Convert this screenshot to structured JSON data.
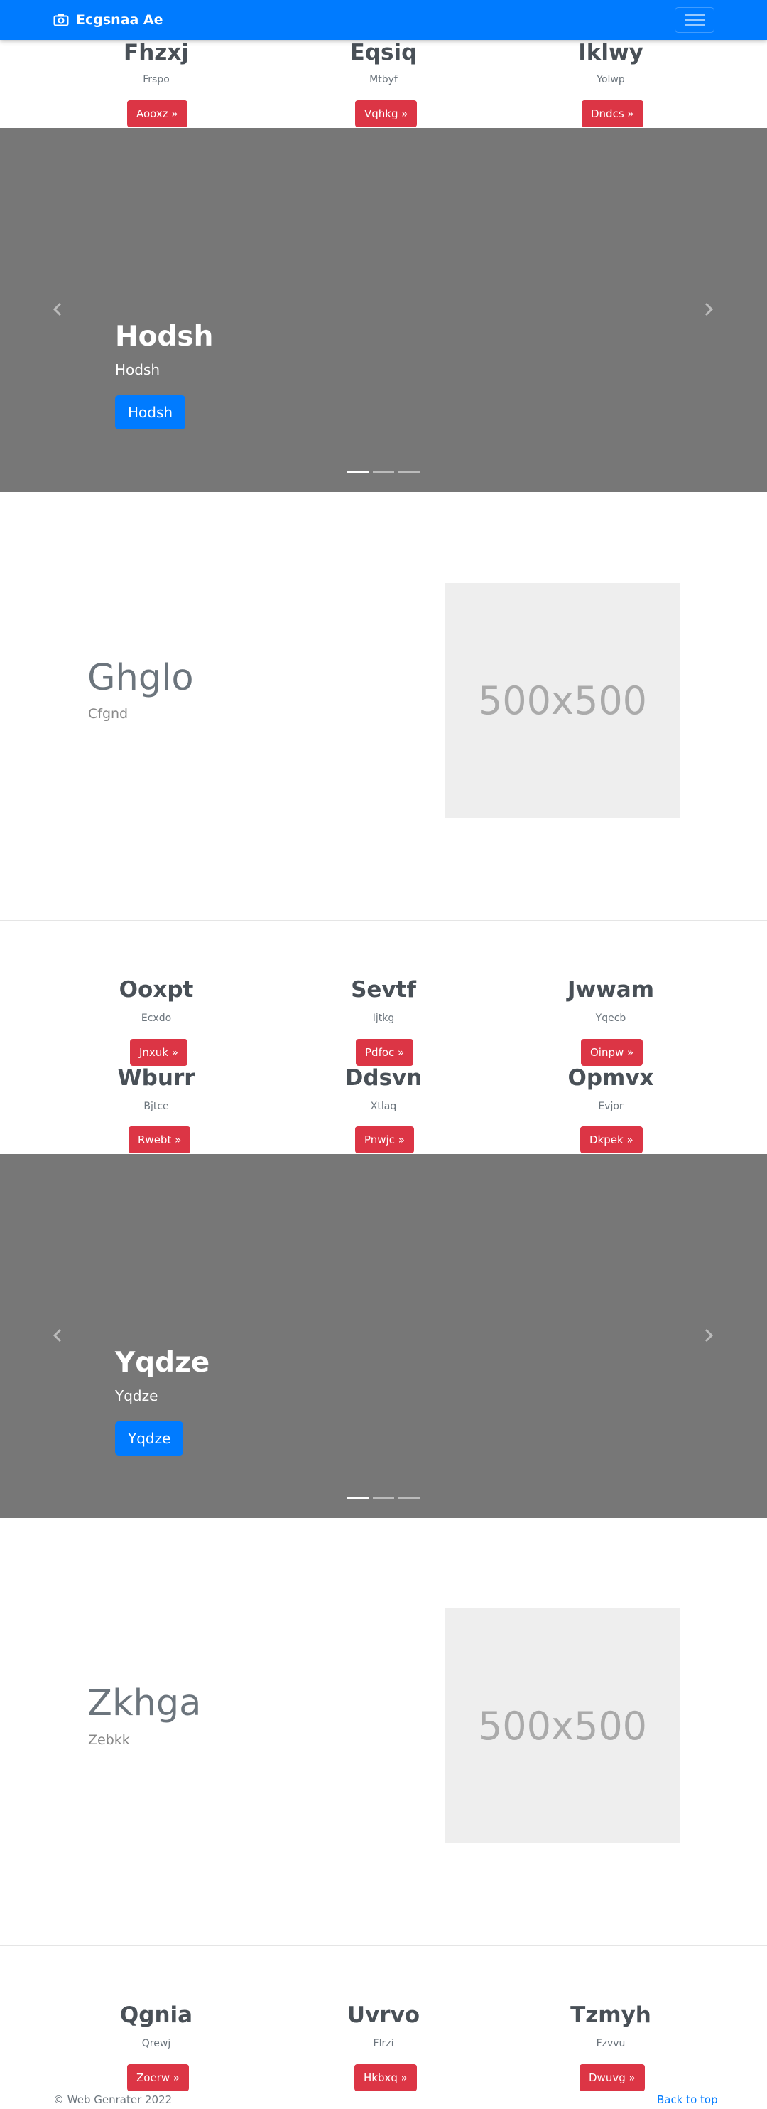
{
  "navbar": {
    "brand": "Ecgsnaa Ae",
    "brand_icon": "camera-icon",
    "menu_icon": "hamburger-icon",
    "color": "#007bff"
  },
  "row1": [
    {
      "title": "Fhzxj",
      "sub": "Frspo",
      "button": "Aooxz »"
    },
    {
      "title": "Eqsiq",
      "sub": "Mtbyf",
      "button": "Vqhkg »"
    },
    {
      "title": "Iklwy",
      "sub": "Yolwp",
      "button": "Dndcs »"
    }
  ],
  "carousel1": {
    "title": "Hodsh",
    "sub": "Hodsh",
    "button": "Hodsh"
  },
  "feature1": {
    "title": "Ghglo",
    "sub": "Cfgnd",
    "placeholder": "500x500"
  },
  "row2": [
    {
      "title": "Ooxpt",
      "sub": "Ecxdo",
      "button": "Jnxuk »"
    },
    {
      "title": "Sevtf",
      "sub": "Ijtkg",
      "button": "Pdfoc »"
    },
    {
      "title": "Jwwam",
      "sub": "Yqecb",
      "button": "Oinpw »"
    }
  ],
  "row3": [
    {
      "title": "Wburr",
      "sub": "Bjtce",
      "button": "Rwebt »"
    },
    {
      "title": "Ddsvn",
      "sub": "Xtlaq",
      "button": "Pnwjc »"
    },
    {
      "title": "Opmvx",
      "sub": "Evjor",
      "button": "Dkpek »"
    }
  ],
  "carousel2": {
    "title": "Yqdze",
    "sub": "Yqdze",
    "button": "Yqdze"
  },
  "feature2": {
    "title": "Zkhga",
    "sub": "Zebkk",
    "placeholder": "500x500"
  },
  "row4": [
    {
      "title": "Qgnia",
      "sub": "Qrewj",
      "button": "Zoerw »"
    },
    {
      "title": "Uvrvo",
      "sub": "Flrzi",
      "button": "Hkbxq »"
    },
    {
      "title": "Tzmyh",
      "sub": "Fzvvu",
      "button": "Dwuvg »"
    }
  ],
  "footer": {
    "copyright": "© Web Genrater 2022",
    "back_to_top": "Back to top"
  }
}
